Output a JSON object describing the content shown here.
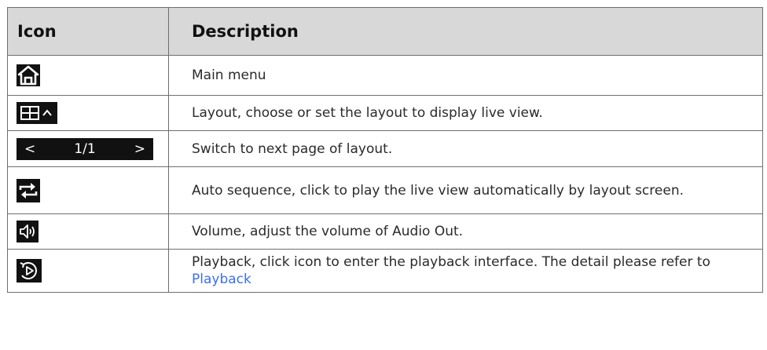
{
  "table": {
    "headers": {
      "icon": "Icon",
      "description": "Description"
    },
    "rows": [
      {
        "icon": "home-icon",
        "description": "Main menu"
      },
      {
        "icon": "layout-grid-icon",
        "description": "Layout, choose or set the layout to display live view."
      },
      {
        "icon": "pager-icon",
        "pager": {
          "prev": "<",
          "page": "1/1",
          "next": ">"
        },
        "description": "Switch to next page of layout."
      },
      {
        "icon": "auto-sequence-icon",
        "description": "Auto sequence, click to play the live view automatically by layout screen."
      },
      {
        "icon": "volume-icon",
        "description": "Volume, adjust the volume of Audio Out."
      },
      {
        "icon": "playback-icon",
        "description": "Playback, click icon to enter the playback interface. The detail please refer to ",
        "link": "Playback"
      }
    ]
  }
}
